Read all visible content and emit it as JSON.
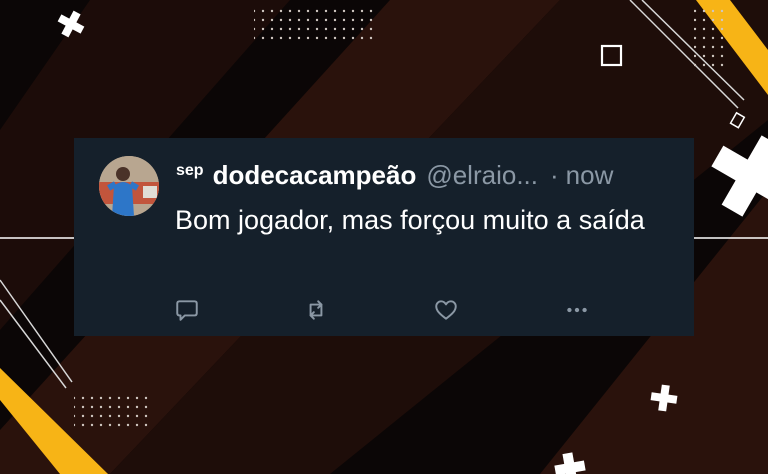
{
  "tweet": {
    "prefix": "sep",
    "display_name": "dodecacampeão",
    "handle": "@elraio...",
    "separator": "·",
    "time": "now",
    "text": "Bom jogador, mas forçou muito a saída"
  },
  "actions": [
    {
      "icon": "reply-icon"
    },
    {
      "icon": "retweet-icon"
    },
    {
      "icon": "like-icon"
    },
    {
      "icon": "more-icon"
    }
  ],
  "colors": {
    "card_bg": "#15202b",
    "text": "#ffffff",
    "muted": "#8b98a5",
    "accent_yellow": "#f7b416",
    "background": "#0b0606"
  }
}
